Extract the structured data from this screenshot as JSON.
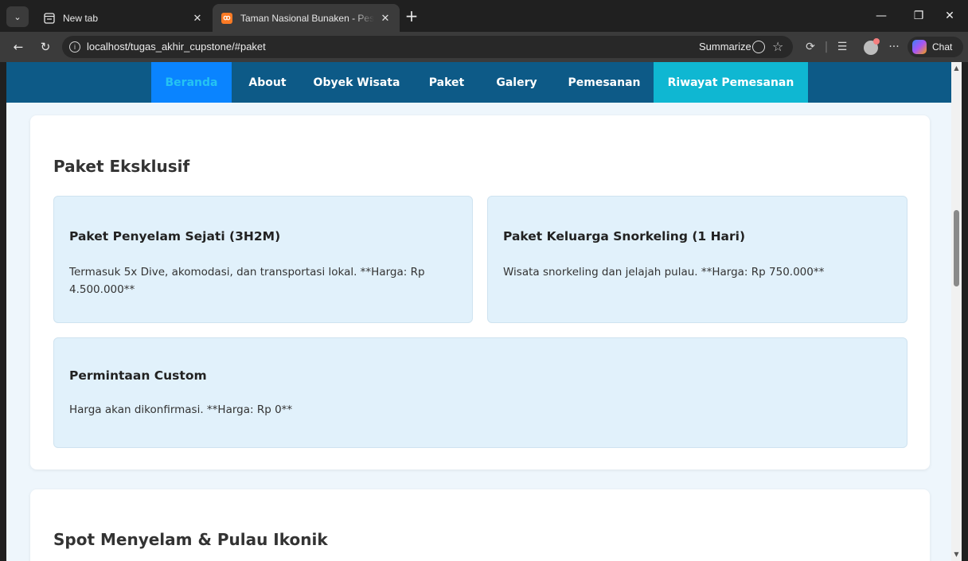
{
  "browser": {
    "tabs": [
      {
        "title": "New tab",
        "active": false,
        "icon": "newtab-icon"
      },
      {
        "title": "Taman Nasional Bunaken - Pesona",
        "active": true,
        "icon": "xampp-icon",
        "icon_text": "ꝏ"
      }
    ],
    "url": "localhost/tugas_akhir_cupstone/#paket",
    "summarize_label": "Summarize",
    "chat_label": "Chat"
  },
  "navbar": {
    "items": [
      {
        "label": "Beranda"
      },
      {
        "label": "About"
      },
      {
        "label": "Obyek Wisata"
      },
      {
        "label": "Paket"
      },
      {
        "label": "Galery"
      },
      {
        "label": "Pemesanan"
      },
      {
        "label": "Riwayat Pemesanan"
      }
    ]
  },
  "paket_section": {
    "title": "Paket Eksklusif",
    "cards": [
      {
        "title": "Paket Penyelam Sejati (3H2M)",
        "description": "Termasuk 5x Dive, akomodasi, dan transportasi lokal. **Harga: Rp 4.500.000**"
      },
      {
        "title": "Paket Keluarga Snorkeling (1 Hari)",
        "description": "Wisata snorkeling dan jelajah pulau. **Harga: Rp 750.000**"
      },
      {
        "title": "Permintaan Custom",
        "description": "Harga akan dikonfirmasi. **Harga: Rp 0**"
      }
    ]
  },
  "spot_section": {
    "title": "Spot Menyelam & Pulau Ikonik"
  },
  "colors": {
    "navbar_bg": "#0d5a87",
    "active_nav_bg": "#0a84ff",
    "riwayat_bg": "#0fb7d2",
    "card_bg": "#e1f1fb",
    "page_bg": "#eef6fc"
  }
}
